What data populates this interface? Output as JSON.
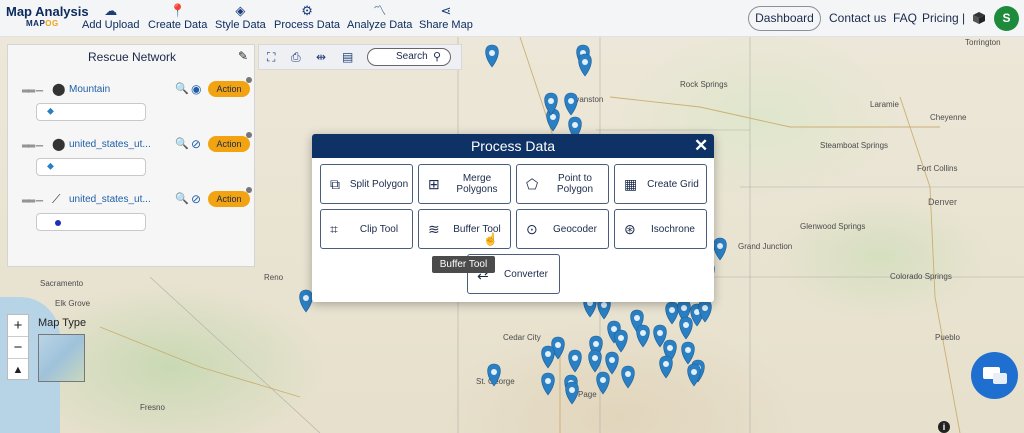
{
  "app": {
    "name": "Map Analysis",
    "sub_prefix": "MAP",
    "sub_suffix": "OG"
  },
  "nav": {
    "add_upload": "Add Upload",
    "create_data": "Create Data",
    "style_data": "Style Data",
    "process_data": "Process Data",
    "analyze_data": "Analyze Data",
    "share_map": "Share Map"
  },
  "header_right": {
    "dashboard": "Dashboard",
    "contact": "Contact us",
    "faq": "FAQ",
    "pricing": "Pricing |",
    "avatar_initial": "S"
  },
  "panel": {
    "title": "Rescue Network",
    "layers": [
      {
        "name": "Mountain",
        "action": "Action",
        "icon": "map-pin-icon",
        "visible": true
      },
      {
        "name": "united_states_ut...",
        "action": "Action",
        "icon": "map-pin-icon",
        "visible": false
      },
      {
        "name": "united_states_ut...",
        "action": "Action",
        "icon": "polyline-icon",
        "visible": false
      }
    ]
  },
  "toolbar": {
    "search_label": "Search"
  },
  "modal": {
    "title": "Process Data",
    "tools": [
      {
        "label": "Split Polygon",
        "icon": "split-polygon-icon"
      },
      {
        "label": "Merge Polygons",
        "icon": "merge-polygons-icon"
      },
      {
        "label": "Point to Polygon",
        "icon": "point-to-polygon-icon"
      },
      {
        "label": "Create Grid",
        "icon": "grid-icon"
      },
      {
        "label": "Clip Tool",
        "icon": "crop-icon"
      },
      {
        "label": "Buffer Tool",
        "icon": "layers-icon"
      },
      {
        "label": "Geocoder",
        "icon": "geocoder-icon"
      },
      {
        "label": "Isochrone",
        "icon": "isochrone-icon"
      },
      {
        "label": "Converter",
        "icon": "converter-icon"
      }
    ],
    "tooltip": "Buffer Tool"
  },
  "map": {
    "type_label": "Map Type",
    "labels": {
      "evanston": "Evanston",
      "rock_springs": "Rock Springs",
      "laramie": "Laramie",
      "cheyenne": "Cheyenne",
      "steamboat": "Steamboat Springs",
      "fort_collins": "Fort Collins",
      "denver": "Denver",
      "glenwood": "Glenwood Springs",
      "colorado_springs": "Colorado Springs",
      "grand_junction": "Grand Junction",
      "sacramento": "Sacramento",
      "elk_grove": "Elk Grove",
      "fresno": "Fresno",
      "cedar_city": "Cedar City",
      "st_george": "St. George",
      "page": "Page",
      "pueblo": "Pueblo",
      "torrington": "Torrington",
      "reno": "Reno"
    }
  },
  "colors": {
    "navy": "#0e3266",
    "accent_orange": "#f2a312",
    "link_blue": "#1f5fa8",
    "marker_blue": "#2b7fc3",
    "avatar_green": "#1e8a3b",
    "chat_blue": "#1e6fd0"
  }
}
